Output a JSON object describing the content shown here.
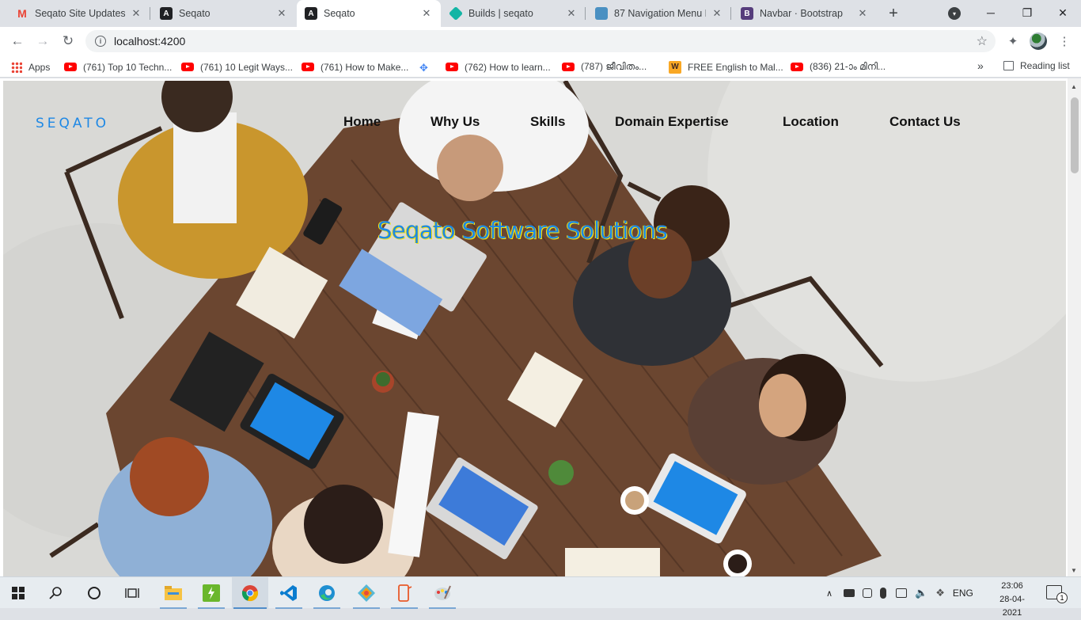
{
  "browser": {
    "tabs": [
      {
        "title": "Seqato Site Updates | ",
        "icon": "gmail-icon",
        "icon_color": "#ea4335",
        "active": false
      },
      {
        "title": "Seqato",
        "icon": "angular-icon",
        "icon_color": "#202124",
        "active": false
      },
      {
        "title": "Seqato",
        "icon": "angular-icon",
        "icon_color": "#202124",
        "active": true
      },
      {
        "title": "Builds | seqato",
        "icon": "builds-icon",
        "icon_color": "#12b5a5",
        "active": false
      },
      {
        "title": "87 Navigation Menu D",
        "icon": "navmenu-icon",
        "icon_color": "#4a90c2",
        "active": false
      },
      {
        "title": "Navbar · Bootstrap",
        "icon": "bootstrap-icon",
        "icon_color": "#563d7c",
        "active": false
      }
    ],
    "new_tab": "+",
    "address": "localhost:4200",
    "bookmarks": [
      {
        "label": "Apps",
        "icon": "apps-grid-icon"
      },
      {
        "label": "(761) Top 10 Techn...",
        "icon": "youtube-icon"
      },
      {
        "label": "(761) 10 Legit Ways...",
        "icon": "youtube-icon"
      },
      {
        "label": "(761) How to Make...",
        "icon": "youtube-icon"
      },
      {
        "label": "",
        "icon": "gemini-icon"
      },
      {
        "label": "(762) How to learn...",
        "icon": "youtube-icon"
      },
      {
        "label": "(787) ജീവിതം...",
        "icon": "youtube-icon"
      },
      {
        "label": "FREE English to Mal...",
        "icon": "wordpress-icon"
      },
      {
        "label": "(836) 21-ാം മിനി...",
        "icon": "youtube-icon"
      }
    ],
    "more_bookmarks": "»",
    "reading_list": "Reading list"
  },
  "page": {
    "brand": "SEQATO",
    "nav": [
      "Home",
      "Why Us",
      "Skills",
      "Domain Expertise",
      "Location",
      "Contact Us"
    ],
    "hero_title": "Seqato Software Solutions",
    "accent": "#1e88e5",
    "title_outline": "#f9e50b"
  },
  "taskbar": {
    "language": "ENG",
    "time": "23:06",
    "date": "28-04-2021",
    "notifications": "1"
  }
}
